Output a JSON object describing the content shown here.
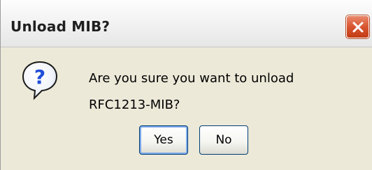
{
  "window": {
    "title": "Unload MIB?"
  },
  "dialog": {
    "icon": "question-icon",
    "message_lines": [
      "Are you sure you want to unload",
      "RFC1213-MIB?"
    ]
  },
  "buttons": {
    "yes_label": "Yes",
    "no_label": "No"
  },
  "colors": {
    "window_bg": "#ECE9D8",
    "close_button": "#D9552F",
    "question_icon_accent": "#1F4ED8"
  }
}
